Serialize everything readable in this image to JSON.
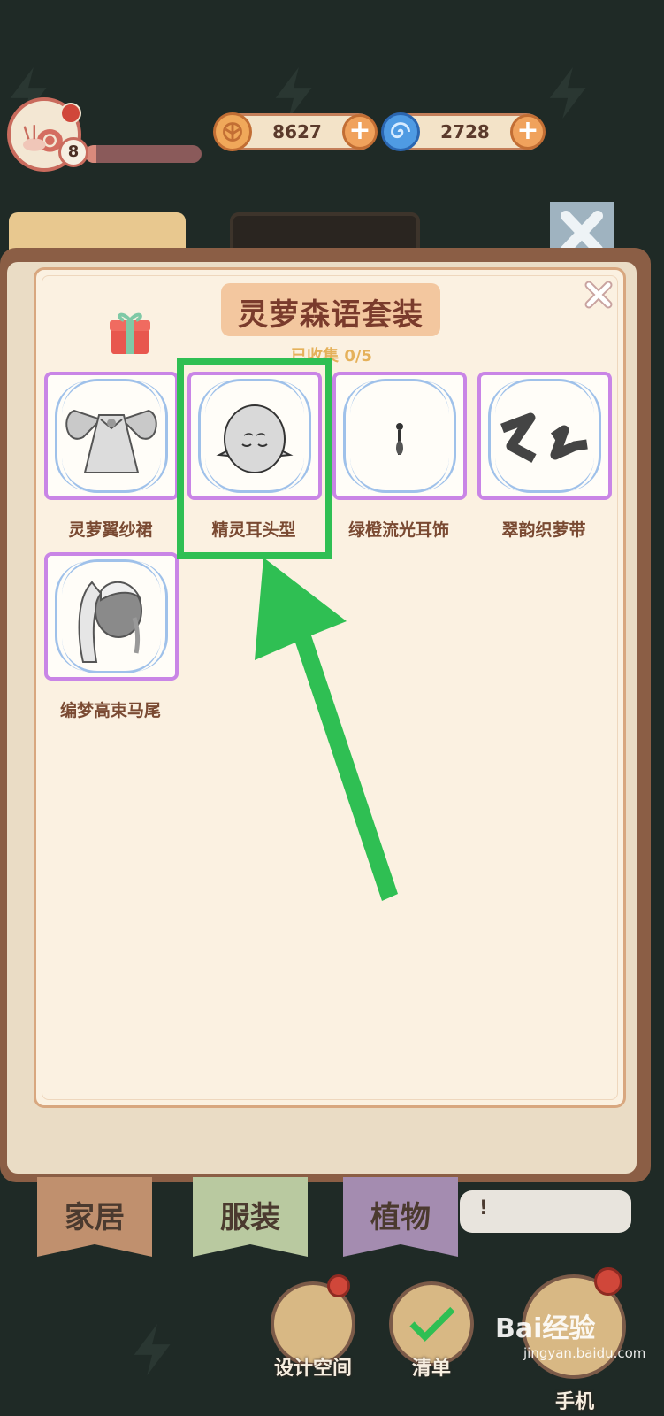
{
  "hud": {
    "level": "8",
    "xp_progress": 0.1,
    "coins": "8627",
    "gems": "2728"
  },
  "panel": {
    "title": "灵萝森语套装",
    "progress": "已收集 0/5",
    "items": [
      {
        "name": "灵萝翼纱裙",
        "icon": "winged-dress"
      },
      {
        "name": "精灵耳头型",
        "icon": "elf-ear-head"
      },
      {
        "name": "绿橙流光耳饰",
        "icon": "earring"
      },
      {
        "name": "翠韵织萝带",
        "icon": "ribbon"
      },
      {
        "name": "编梦高束马尾",
        "icon": "ponytail"
      }
    ],
    "highlighted_item": "精灵耳头型"
  },
  "bottom_tabs": [
    "家居",
    "服装",
    "植物"
  ],
  "bubble_text": "!",
  "actions": [
    "设计空间",
    "清单",
    "手机"
  ],
  "watermark": {
    "brand": "Bai经验",
    "url": "jingyan.baidu.com"
  },
  "colors": {
    "highlight": "#2fbf53",
    "frame": "#c985e6",
    "title": "#7a3b2c"
  }
}
